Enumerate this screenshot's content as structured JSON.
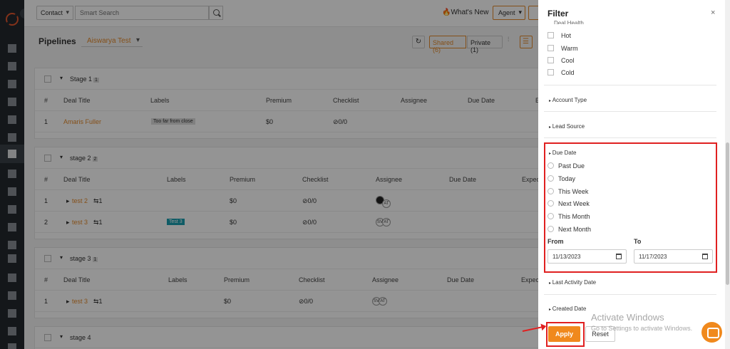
{
  "topbar": {
    "entity_select": "Contact",
    "search_placeholder": "Smart Search",
    "whats_new": "What's New",
    "agent": "Agent"
  },
  "pipeline": {
    "title": "Pipelines",
    "selected": "Aiswarya Test",
    "shared": "Shared (6)",
    "private": "Private (1)"
  },
  "stages": [
    {
      "name": "Stage 1",
      "count": "1",
      "columns": [
        "#",
        "Deal Title",
        "Labels",
        "Premium",
        "Checklist",
        "Assignee",
        "Due Date",
        "E"
      ],
      "rows": [
        {
          "num": "1",
          "title": "Amaris Fuller",
          "label": "Too far from close",
          "premium": "$0",
          "checklist": "0/0"
        }
      ]
    },
    {
      "name": "stage 2",
      "count": "2",
      "columns": [
        "#",
        "Deal Title",
        "Labels",
        "Premium",
        "Checklist",
        "Assignee",
        "Due Date",
        "Expec"
      ],
      "rows": [
        {
          "num": "1",
          "title": "test 2",
          "sub": "1",
          "label": "",
          "premium": "$0",
          "checklist": "0/0",
          "assignees": [
            "",
            "AT"
          ]
        },
        {
          "num": "2",
          "title": "test 3",
          "sub": "1",
          "label": "Test 3",
          "premium": "$0",
          "checklist": "0/0",
          "assignees": [
            "SV",
            "AT"
          ]
        }
      ]
    },
    {
      "name": "stage 3",
      "count": "1",
      "columns": [
        "#",
        "Deal Title",
        "Labels",
        "Premium",
        "Checklist",
        "Assignee",
        "Due Date",
        "Expec"
      ],
      "rows": [
        {
          "num": "1",
          "title": "test 3",
          "sub": "1",
          "label": "",
          "premium": "$0",
          "checklist": "0/0",
          "assignees": [
            "SV",
            "AT"
          ]
        }
      ]
    },
    {
      "name": "stage 4",
      "count": ""
    }
  ],
  "filter": {
    "title": "Filter",
    "close": "×",
    "deal_health_label": "Deal Health",
    "health_options": [
      "Hot",
      "Warm",
      "Cool",
      "Cold"
    ],
    "account_type": "Account Type",
    "lead_source": "Lead Source",
    "due_date": {
      "label": "Due Date",
      "options": [
        "Past Due",
        "Today",
        "This Week",
        "Next Week",
        "This Month",
        "Next Month"
      ],
      "from_label": "From",
      "to_label": "To",
      "from_value": "11/13/2023",
      "to_value": "11/17/2023"
    },
    "last_activity": "Last Activity Date",
    "created_date": "Created Date",
    "apply": "Apply",
    "reset": "Reset"
  },
  "watermark": {
    "line1": "Activate Windows",
    "line2": "Go to Settings to activate Windows."
  },
  "colors": {
    "accent": "#f0891d",
    "annotation": "#e02020",
    "teal_label": "#1a9fb0"
  }
}
